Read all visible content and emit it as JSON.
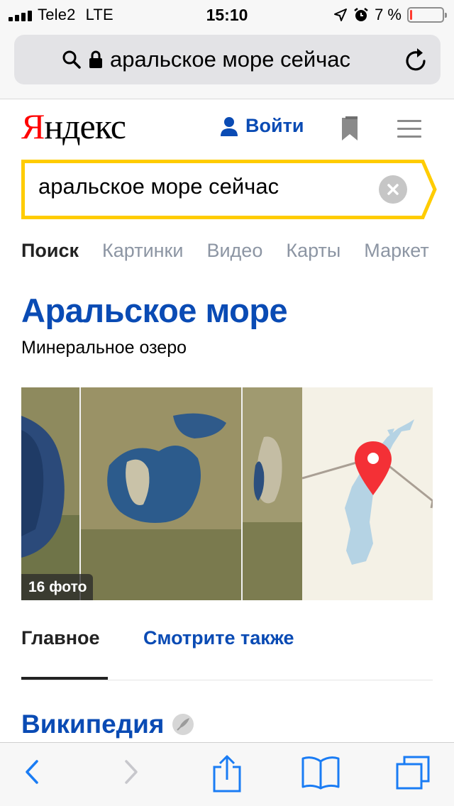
{
  "status_bar": {
    "carrier": "Tele2",
    "network": "LTE",
    "time": "15:10",
    "battery_percent": "7 %",
    "battery_level": 0.07,
    "icons": [
      "signal-icon",
      "location-arrow-icon",
      "alarm-icon",
      "battery-icon"
    ]
  },
  "browser": {
    "url_text": "аральское море сейчас",
    "icons": [
      "search-icon",
      "lock-icon",
      "reload-icon"
    ]
  },
  "header": {
    "logo_first": "Я",
    "logo_rest": "ндекс",
    "login_label": "Войти",
    "colors": {
      "logo_red": "#ff0000",
      "link_blue": "#0a4bb4",
      "search_border": "#ffcc00"
    }
  },
  "search": {
    "query": "аральское море сейчас"
  },
  "tabs": [
    {
      "label": "Поиск",
      "active": true
    },
    {
      "label": "Картинки",
      "active": false
    },
    {
      "label": "Видео",
      "active": false
    },
    {
      "label": "Карты",
      "active": false
    },
    {
      "label": "Маркет",
      "active": false
    }
  ],
  "entity": {
    "title": "Аральское море",
    "subtitle": "Минеральное озеро",
    "photo_count": "16 фото"
  },
  "sub_tabs": {
    "main": "Главное",
    "see_also": "Смотрите также"
  },
  "wiki": {
    "label": "Википедия"
  }
}
